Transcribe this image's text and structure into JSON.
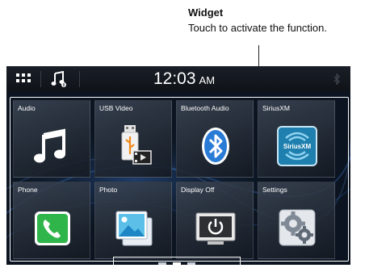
{
  "callout": {
    "title": "Widget",
    "description": "Touch to activate the function."
  },
  "statusbar": {
    "time": "12:03",
    "ampm": "AM",
    "icons": [
      "grid-menu-icon",
      "music-source-icon",
      "bluetooth-status-icon"
    ]
  },
  "tiles": [
    {
      "label": "Audio",
      "icon": "music-note-icon"
    },
    {
      "label": "USB Video",
      "icon": "usb-video-icon"
    },
    {
      "label": "Bluetooth Audio",
      "icon": "bluetooth-icon"
    },
    {
      "label": "SiriusXM",
      "icon": "siriusxm-icon",
      "logo_text": "SiriusXM"
    },
    {
      "label": "Phone",
      "icon": "phone-icon"
    },
    {
      "label": "Photo",
      "icon": "photo-icon"
    },
    {
      "label": "Display Off",
      "icon": "power-icon"
    },
    {
      "label": "Settings",
      "icon": "gears-icon"
    }
  ],
  "pager": {
    "pages": 3,
    "current": 2
  },
  "colors": {
    "screen_bg": "#0b1420",
    "accent_blue": "#2a7bd6",
    "phone_green": "#2fb54a"
  }
}
